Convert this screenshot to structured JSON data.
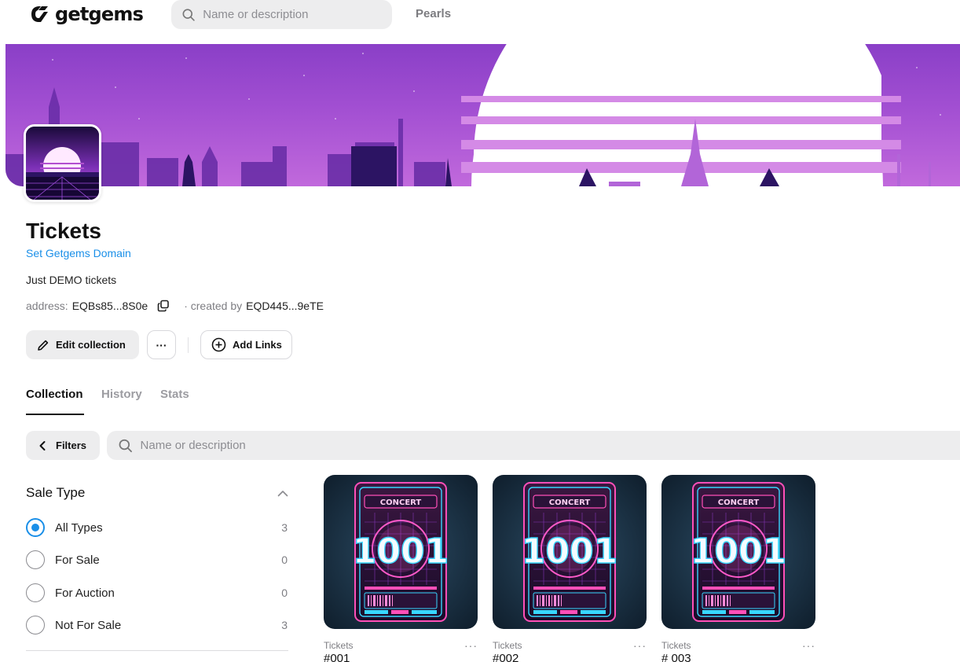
{
  "header": {
    "logo_text": "getgems",
    "search_placeholder": "Name or description",
    "nav": [
      "Pearls"
    ]
  },
  "collection": {
    "title": "Tickets",
    "domain_link": "Set Getgems Domain",
    "description": "Just DEMO tickets",
    "address_label": "address:",
    "address": "EQBs85...8S0e",
    "created_by_label": "· created by",
    "creator": "EQD445...9eTE"
  },
  "actions": {
    "edit_label": "Edit collection",
    "more_label": "···",
    "add_links_label": "Add Links"
  },
  "tabs": [
    "Collection",
    "History",
    "Stats"
  ],
  "active_tab": "Collection",
  "filters": {
    "button_label": "Filters",
    "search_placeholder": "Name or description",
    "sale_type": {
      "title": "Sale Type",
      "options": [
        {
          "label": "All Types",
          "count": "3",
          "selected": true
        },
        {
          "label": "For Sale",
          "count": "0",
          "selected": false
        },
        {
          "label": "For Auction",
          "count": "0",
          "selected": false
        },
        {
          "label": "Not For Sale",
          "count": "3",
          "selected": false
        }
      ]
    }
  },
  "items": [
    {
      "collection": "Tickets",
      "name": "#001",
      "art_text": "1001",
      "art_header": "CONCERT"
    },
    {
      "collection": "Tickets",
      "name": "#002",
      "art_text": "1001",
      "art_header": "CONCERT"
    },
    {
      "collection": "Tickets",
      "name": "# 003",
      "art_text": "1001",
      "art_header": "CONCERT"
    }
  ],
  "colors": {
    "accent": "#1a8fe8",
    "banner_purple": "#a24fd2",
    "surface_gray": "#ededee"
  }
}
